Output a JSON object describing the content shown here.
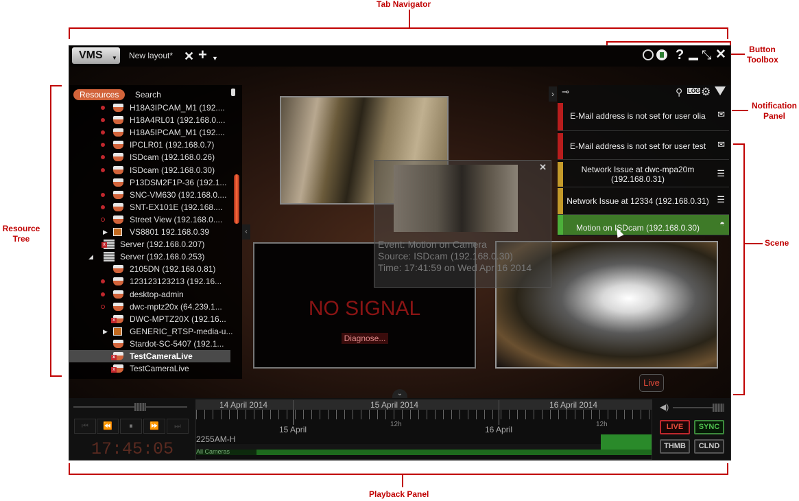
{
  "annotations": {
    "tab_navigator": "Tab Navigator",
    "button_toolbox": "Button Toolbox",
    "notification_panel": "Notification Panel",
    "resource_tree": "Resource Tree",
    "scene": "Scene",
    "playback_panel": "Playback Panel"
  },
  "topbar": {
    "app_menu": "VMS",
    "layout_tab": "New layout*"
  },
  "resources": {
    "tab_resources": "Resources",
    "tab_search": "Search",
    "items": [
      {
        "label": "H18A3IPCAM_M1 (192....",
        "icon": "camera-icon",
        "status": "recording"
      },
      {
        "label": "H18A4RL01 (192.168.0....",
        "icon": "camera-icon",
        "status": "recording"
      },
      {
        "label": "H18A5IPCAM_M1 (192....",
        "icon": "camera-icon",
        "status": "recording"
      },
      {
        "label": "IPCLR01 (192.168.0.7)",
        "icon": "camera-icon",
        "status": "recording"
      },
      {
        "label": "ISDcam (192.168.0.26)",
        "icon": "camera-icon",
        "status": "recording"
      },
      {
        "label": "ISDcam (192.168.0.30)",
        "icon": "camera-icon",
        "status": "recording"
      },
      {
        "label": "P13DSM2F1P-36 (192.1...",
        "icon": "camera-icon",
        "status": "none"
      },
      {
        "label": "SNC-VM630 (192.168.0....",
        "icon": "camera-icon",
        "status": "recording"
      },
      {
        "label": "SNT-EX101E (192.168....",
        "icon": "camera-icon",
        "status": "recording"
      },
      {
        "label": "Street View (192.168.0....",
        "icon": "camera-icon",
        "status": "scheduled"
      },
      {
        "label": "VS8801 192.168.0.39",
        "icon": "encoder-icon",
        "status": "expand"
      },
      {
        "label": "Server (192.168.0.207)",
        "icon": "server-offline-icon",
        "status": "server"
      },
      {
        "label": "Server (192.168.0.253)",
        "icon": "server-icon",
        "status": "server-open"
      },
      {
        "label": "2105DN (192.168.0.81)",
        "icon": "camera-icon",
        "status": "none"
      },
      {
        "label": "123123123213 (192.16...",
        "icon": "camera-icon",
        "status": "recording"
      },
      {
        "label": "desktop-admin",
        "icon": "camera-icon",
        "status": "recording"
      },
      {
        "label": "dwc-mptz20x (64.239.1...",
        "icon": "camera-icon",
        "status": "scheduled"
      },
      {
        "label": "DWC-MPTZ20X (192.16...",
        "icon": "camera-offline-icon",
        "status": "none"
      },
      {
        "label": "GENERIC_RTSP-media-u...",
        "icon": "encoder-icon",
        "status": "expand"
      },
      {
        "label": "Stardot-SC-5407 (192.1...",
        "icon": "camera-icon",
        "status": "none"
      },
      {
        "label": "TestCameraLive",
        "icon": "camera-offline-icon",
        "status": "selected"
      },
      {
        "label": "TestCameraLive",
        "icon": "camera-offline-icon",
        "status": "none"
      }
    ]
  },
  "scene": {
    "no_signal": "NO SIGNAL",
    "diagnose": "Diagnose...",
    "tooltip": {
      "event": "Event: Motion on Camera",
      "source": "Source: ISDcam (192.168.0.30)",
      "time": "Time: 17:41:59 on Wed Apr 16 2014"
    }
  },
  "notifications": [
    {
      "text": "E-Mail address is not set for user olia",
      "color": "#b81d1d",
      "icon": "mail-warning-icon"
    },
    {
      "text": "E-Mail address is not set for user test",
      "color": "#b81d1d",
      "icon": "mail-warning-icon"
    },
    {
      "text": "Network Issue at dwc-mpa20m (192.168.0.31)",
      "color": "#c49a2a",
      "icon": "server-log-icon"
    },
    {
      "text": "Network Issue at 12334 (192.168.0.31)",
      "color": "#c49a2a",
      "icon": "server-log-icon"
    },
    {
      "text": "Motion on ISDcam (192.168.0.30)",
      "color": "#4caf3a",
      "icon": "camera-icon"
    }
  ],
  "notifications_log_label": "LOG",
  "playback": {
    "live_tag": "Live",
    "dates": [
      "14 April 2014",
      "15 April 2014",
      "16 April 2014"
    ],
    "ticks": [
      "15 April",
      "12h",
      "16 April",
      "12h"
    ],
    "camera_name": "2255AM-H",
    "all_cameras": "All Cameras",
    "time": "17:45:05",
    "buttons": {
      "live": "LIVE",
      "sync": "SYNC",
      "thmb": "THMB",
      "clnd": "CLND"
    }
  }
}
